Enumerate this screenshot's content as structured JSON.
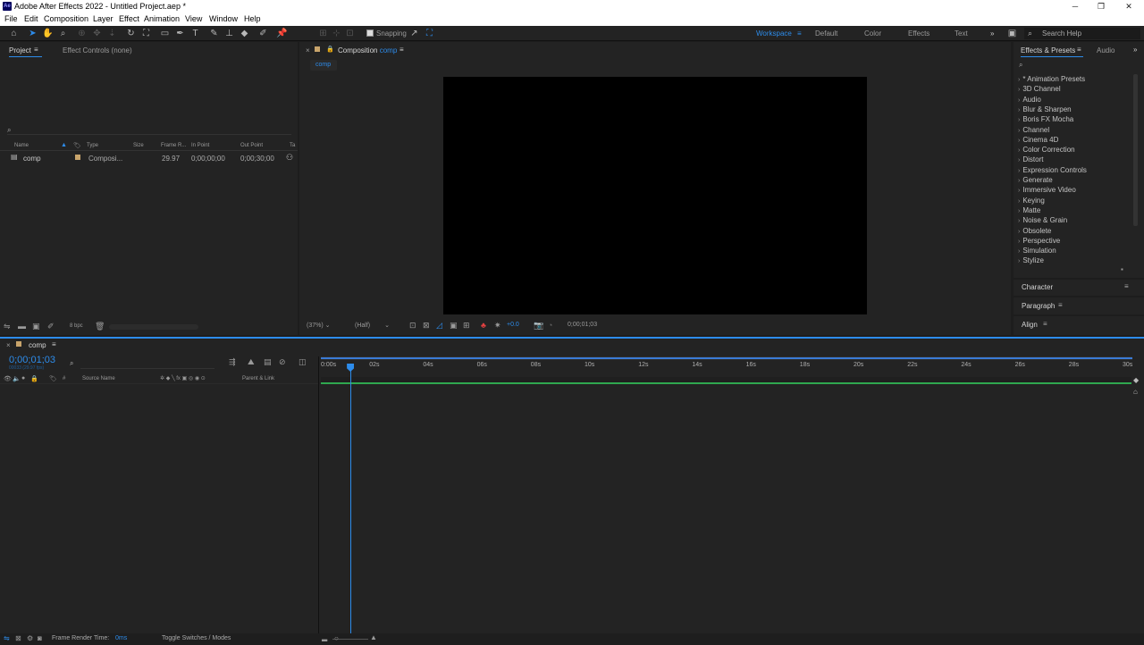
{
  "titlebar": {
    "app_icon": "Ae",
    "title": "Adobe After Effects 2022 - Untitled Project.aep *",
    "minimize": "─",
    "restore": "❐",
    "close": "✕"
  },
  "menubar": {
    "items": [
      "File",
      "Edit",
      "Composition",
      "Layer",
      "Effect",
      "Animation",
      "View",
      "Window",
      "Help"
    ]
  },
  "toolbar": {
    "snapping_label": "Snapping",
    "workspace_label": "Workspace",
    "workspaces": [
      "Default",
      "Color",
      "Effects",
      "Text"
    ],
    "overflow": "»",
    "search_help": "Search Help"
  },
  "project_panel": {
    "tab_project": "Project",
    "tab_effect_controls": "Effect Controls (none)",
    "search_icon": "⌕",
    "columns": [
      "Name",
      "Type",
      "Size",
      "Frame R...",
      "In Point",
      "Out Point",
      "Ta"
    ],
    "rows": [
      {
        "name": "comp",
        "type": "Composi...",
        "size": "",
        "frame_rate": "29.97",
        "in_point": "0;00;00;00",
        "out_point": "0;00;30;00"
      }
    ],
    "bpc": "8 bpc"
  },
  "composition_panel": {
    "close": "×",
    "lock_icon": "🔒",
    "tab_prefix": "Composition",
    "tab_name": "comp",
    "breadcrumb": "comp",
    "zoom": "(37%)",
    "resolution": "(Half)",
    "exposure": "+0.0",
    "timecode": "0;00;01;03"
  },
  "effects_panel": {
    "tab_effects": "Effects & Presets",
    "tab_audio": "Audio",
    "search_icon": "⌕",
    "categories": [
      "* Animation Presets",
      "3D Channel",
      "Audio",
      "Blur & Sharpen",
      "Boris FX Mocha",
      "Channel",
      "Cinema 4D",
      "Color Correction",
      "Distort",
      "Expression Controls",
      "Generate",
      "Immersive Video",
      "Keying",
      "Matte",
      "Noise & Grain",
      "Obsolete",
      "Perspective",
      "Simulation",
      "Stylize"
    ],
    "character": "Character",
    "paragraph": "Paragraph",
    "align": "Align"
  },
  "timeline": {
    "close": "×",
    "comp_name": "comp",
    "timecode": "0;00;01;03",
    "timecode_sub": "00033 (29.97 fps)",
    "col_source_name": "Source Name",
    "col_parent": "Parent & Link",
    "ruler": [
      "0:00s",
      "02s",
      "04s",
      "06s",
      "08s",
      "10s",
      "12s",
      "14s",
      "16s",
      "18s",
      "20s",
      "22s",
      "24s",
      "26s",
      "28s",
      "30s"
    ],
    "playhead_time_s": 1.1,
    "duration_s": 30,
    "frame_render_label": "Frame Render Time:",
    "frame_render_value": "0ms",
    "toggle_label": "Toggle Switches / Modes"
  }
}
